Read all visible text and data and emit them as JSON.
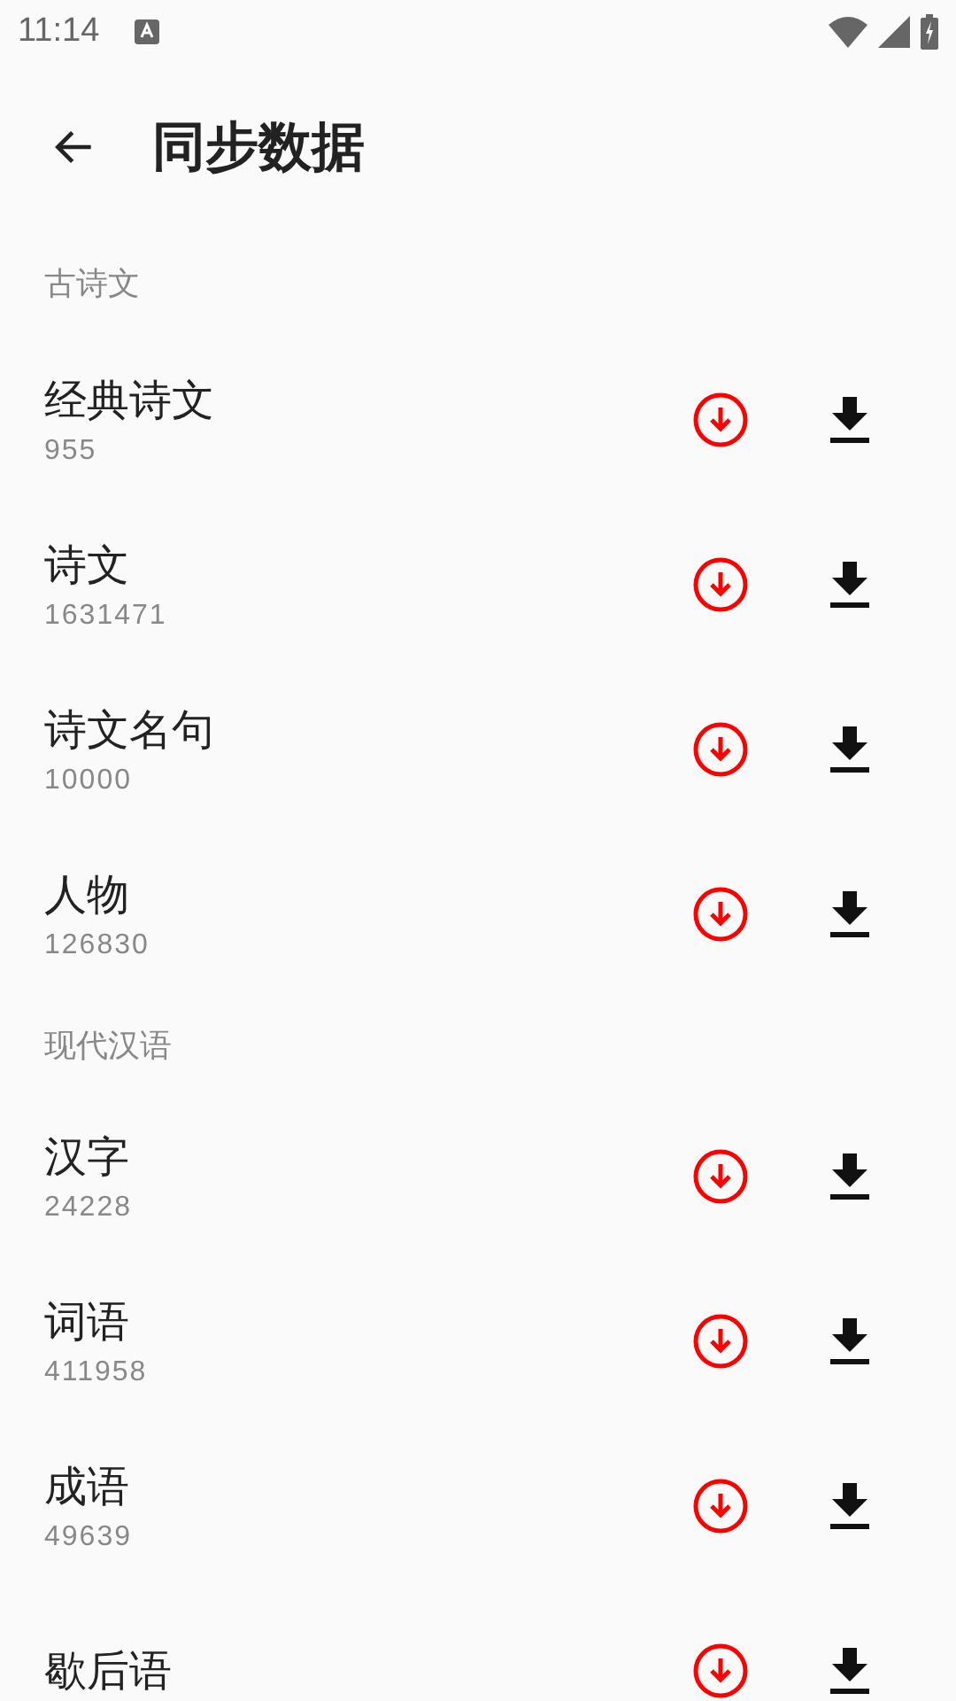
{
  "status_bar": {
    "time": "11:14"
  },
  "toolbar": {
    "title": "同步数据"
  },
  "sections": [
    {
      "title": "古诗文",
      "items": [
        {
          "name": "经典诗文",
          "count": "955"
        },
        {
          "name": "诗文",
          "count": "1631471"
        },
        {
          "name": "诗文名句",
          "count": "10000"
        },
        {
          "name": "人物",
          "count": "126830"
        }
      ]
    },
    {
      "title": "现代汉语",
      "items": [
        {
          "name": "汉字",
          "count": "24228"
        },
        {
          "name": "词语",
          "count": "411958"
        },
        {
          "name": "成语",
          "count": "49639"
        },
        {
          "name": "歇后语"
        }
      ]
    }
  ]
}
